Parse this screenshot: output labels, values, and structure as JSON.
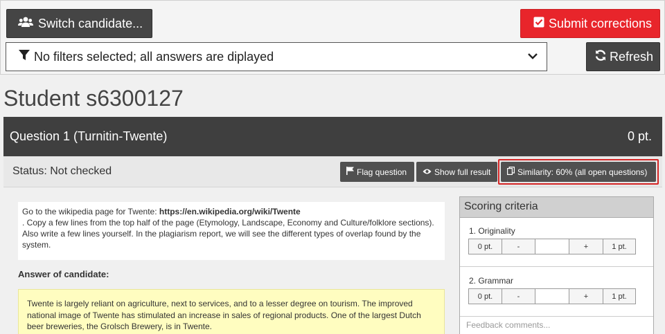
{
  "toolbar": {
    "switch_label": "Switch candidate...",
    "submit_label": "Submit corrections",
    "filter_text": "No filters selected; all answers are diplayed",
    "refresh_label": "Refresh"
  },
  "student": {
    "title": "Student s6300127"
  },
  "question": {
    "title": "Question 1 (Turnitin-Twente)",
    "points": "0 pt.",
    "status": "Status: Not checked",
    "flag_label": "Flag question",
    "show_label": "Show full result",
    "similarity_label": "Similarity: 60% (all open questions)",
    "prompt_intro": "Go to the wikipedia page for Twente: ",
    "prompt_link": "https://en.wikipedia.org/wiki/Twente",
    "prompt_rest": ". Copy a few lines from the top half of the page (Etymology, Landscape, Economy and Culture/folklore sections). Also write a few lines yourself. In the plagiarism report, we will see the different types of overlap found by the system.",
    "answer_label": "Answer of candidate:",
    "answer_text": "Twente is largely reliant on agriculture, next to services, and to a lesser degree on tourism. The improved national image of Twente has stimulated an increase in sales of regional products. One of the largest Dutch beer breweries, the Grolsch Brewery, is in Twente."
  },
  "scoring": {
    "title": "Scoring criteria",
    "criteria": [
      {
        "name": "1. Originality",
        "min": "0 pt.",
        "minus": "-",
        "value": "",
        "plus": "+",
        "max": "1 pt."
      },
      {
        "name": "2. Grammar",
        "min": "0 pt.",
        "minus": "-",
        "value": "",
        "plus": "+",
        "max": "1 pt."
      }
    ],
    "feedback_placeholder": "Feedback comments..."
  },
  "colors": {
    "accent_red": "#e8252b",
    "dark": "#3f3f3f",
    "answer_bg": "#fffdc0"
  },
  "icons": [
    "users-icon",
    "checkbox-icon",
    "filter-icon",
    "chevron-down-icon",
    "refresh-icon",
    "flag-icon",
    "eye-icon",
    "copy-icon"
  ]
}
